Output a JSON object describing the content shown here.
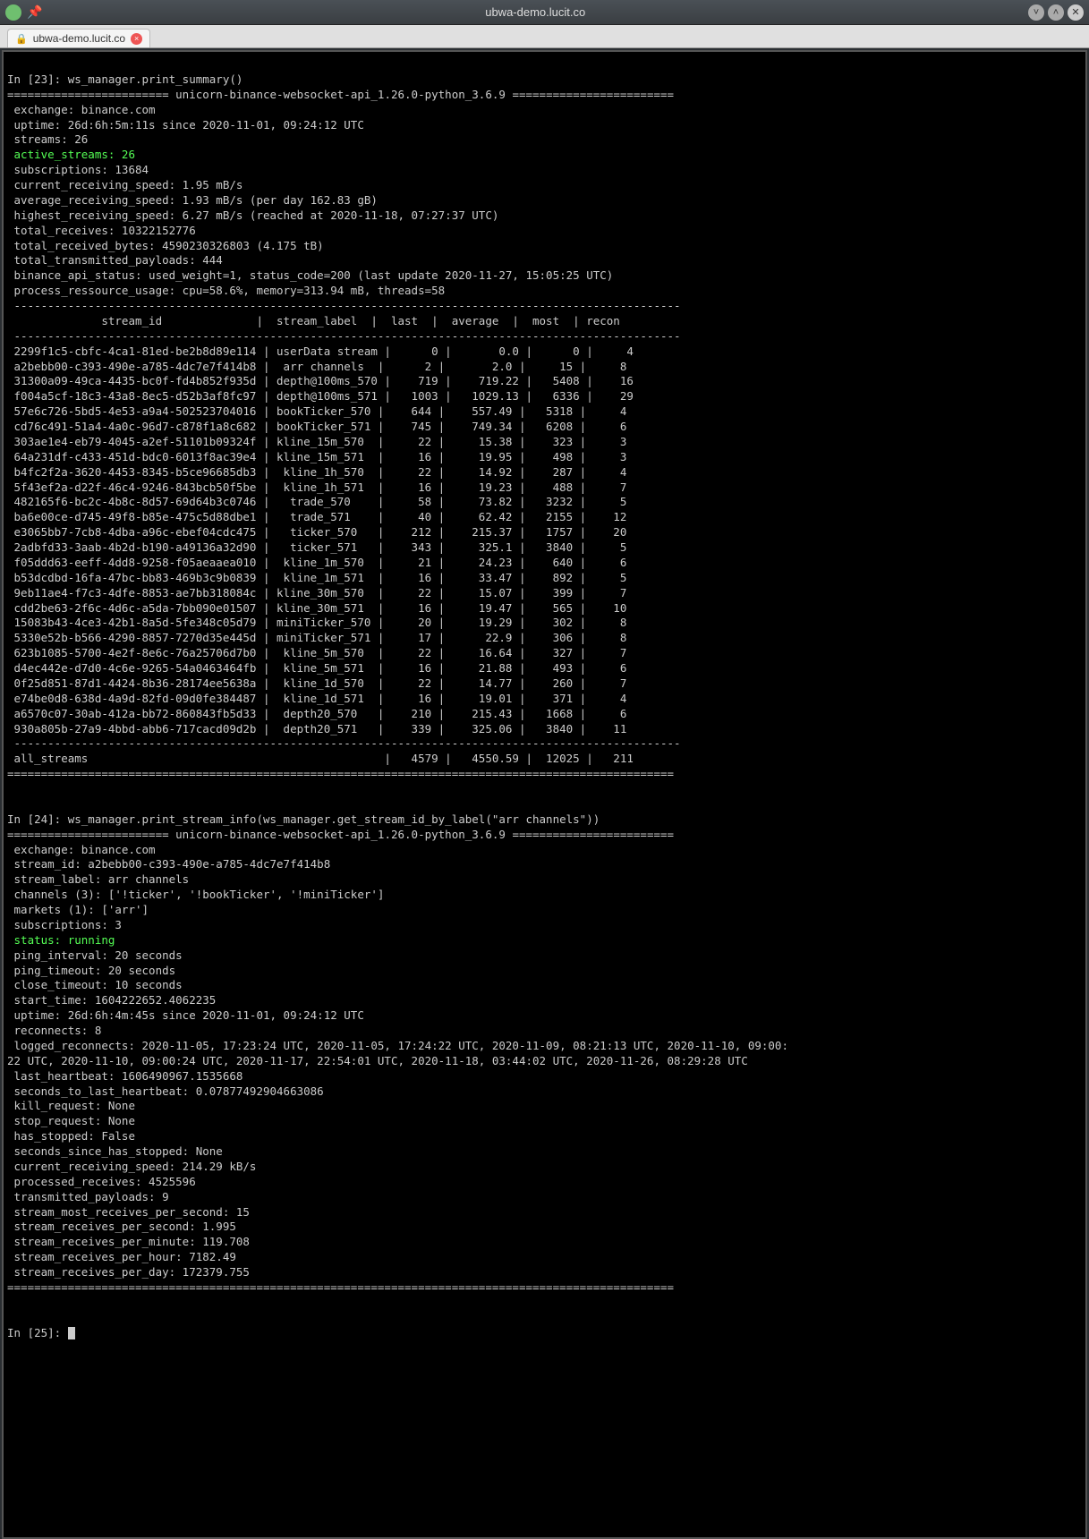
{
  "window": {
    "title": "ubwa-demo.lucit.co",
    "tab_label": "ubwa-demo.lucit.co"
  },
  "session1": {
    "prompt": "In [23]: ",
    "command": "ws_manager.print_summary()",
    "banner_left": "========================",
    "banner_mid": " unicorn-binance-websocket-api_1.26.0-python_3.6.9 ",
    "banner_right": "========================",
    "lines": {
      "exchange": " exchange: binance.com",
      "uptime": " uptime: 26d:6h:5m:11s since 2020-11-01, 09:24:12 UTC",
      "streams": " streams: 26",
      "active_streams": " active_streams: 26",
      "subscriptions": " subscriptions: 13684",
      "crs": " current_receiving_speed: 1.95 mB/s",
      "ars": " average_receiving_speed: 1.93 mB/s (per day 162.83 gB)",
      "hrs": " highest_receiving_speed: 6.27 mB/s (reached at 2020-11-18, 07:27:37 UTC)",
      "total_receives": " total_receives: 10322152776",
      "total_received_bytes": " total_received_bytes: 4590230326803 (4.175 tB)",
      "ttp": " total_transmitted_payloads: 444",
      "api_status": " binance_api_status: used_weight=1, status_code=200 (last update 2020-11-27, 15:05:25 UTC)",
      "ressource": " process_ressource_usage: cpu=58.6%, memory=313.94 mB, threads=58"
    },
    "sep": " ---------------------------------------------------------------------------------------------------",
    "header": "              stream_id              |  stream_label  |  last  |  average  |  most  | recon",
    "rows": [
      " 2299f1c5-cbfc-4ca1-81ed-be2b8d89e114 | userData stream |      0 |       0.0 |      0 |     4",
      " a2bebb00-c393-490e-a785-4dc7e7f414b8 |  arr channels  |      2 |       2.0 |     15 |     8",
      " 31300a09-49ca-4435-bc0f-fd4b852f935d | depth@100ms_570 |    719 |    719.22 |   5408 |    16",
      " f004a5cf-18c3-43a8-8ec5-d52b3af8fc97 | depth@100ms_571 |   1003 |   1029.13 |   6336 |    29",
      " 57e6c726-5bd5-4e53-a9a4-502523704016 | bookTicker_570 |    644 |    557.49 |   5318 |     4",
      " cd76c491-51a4-4a0c-96d7-c878f1a8c682 | bookTicker_571 |    745 |    749.34 |   6208 |     6",
      " 303ae1e4-eb79-4045-a2ef-51101b09324f | kline_15m_570  |     22 |     15.38 |    323 |     3",
      " 64a231df-c433-451d-bdc0-6013f8ac39e4 | kline_15m_571  |     16 |     19.95 |    498 |     3",
      " b4fc2f2a-3620-4453-8345-b5ce96685db3 |  kline_1h_570  |     22 |     14.92 |    287 |     4",
      " 5f43ef2a-d22f-46c4-9246-843bcb50f5be |  kline_1h_571  |     16 |     19.23 |    488 |     7",
      " 482165f6-bc2c-4b8c-8d57-69d64b3c0746 |   trade_570    |     58 |     73.82 |   3232 |     5",
      " ba6e00ce-d745-49f8-b85e-475c5d88dbe1 |   trade_571    |     40 |     62.42 |   2155 |    12",
      " e3065bb7-7cb8-4dba-a96c-ebef04cdc475 |   ticker_570   |    212 |    215.37 |   1757 |    20",
      " 2adbfd33-3aab-4b2d-b190-a49136a32d90 |   ticker_571   |    343 |     325.1 |   3840 |     5",
      " f05ddd63-eeff-4dd8-9258-f05aeaaea010 |  kline_1m_570  |     21 |     24.23 |    640 |     6",
      " b53dcdbd-16fa-47bc-bb83-469b3c9b0839 |  kline_1m_571  |     16 |     33.47 |    892 |     5",
      " 9eb11ae4-f7c3-4dfe-8853-ae7bb318084c | kline_30m_570  |     22 |     15.07 |    399 |     7",
      " cdd2be63-2f6c-4d6c-a5da-7bb090e01507 | kline_30m_571  |     16 |     19.47 |    565 |    10",
      " 15083b43-4ce3-42b1-8a5d-5fe348c05d79 | miniTicker_570 |     20 |     19.29 |    302 |     8",
      " 5330e52b-b566-4290-8857-7270d35e445d | miniTicker_571 |     17 |      22.9 |    306 |     8",
      " 623b1085-5700-4e2f-8e6c-76a25706d7b0 |  kline_5m_570  |     22 |     16.64 |    327 |     7",
      " d4ec442e-d7d0-4c6e-9265-54a0463464fb |  kline_5m_571  |     16 |     21.88 |    493 |     6",
      " 0f25d851-87d1-4424-8b36-28174ee5638a |  kline_1d_570  |     22 |     14.77 |    260 |     7",
      " e74be0d8-638d-4a9d-82fd-09d0fe384487 |  kline_1d_571  |     16 |     19.01 |    371 |     4",
      " a6570c07-30ab-412a-bb72-860843fb5d33 |  depth20_570   |    210 |    215.43 |   1668 |     6",
      " 930a805b-27a9-4bbd-abb6-717cacd09d2b |  depth20_571   |    339 |    325.06 |   3840 |    11"
    ],
    "footer_row": " all_streams                                            |   4579 |   4550.59 |  12025 |   211",
    "footer_sep": "==================================================================================================="
  },
  "session2": {
    "prompt": "In [24]: ",
    "command": "ws_manager.print_stream_info(ws_manager.get_stream_id_by_label(\"arr channels\"))",
    "banner_left": "========================",
    "banner_mid": " unicorn-binance-websocket-api_1.26.0-python_3.6.9 ",
    "banner_right": "========================",
    "lines": {
      "exchange": " exchange: binance.com",
      "stream_id": " stream_id: a2bebb00-c393-490e-a785-4dc7e7f414b8",
      "stream_label": " stream_label: arr channels",
      "channels": " channels (3): ['!ticker', '!bookTicker', '!miniTicker']",
      "markets": " markets (1): ['arr']",
      "subscriptions": " subscriptions: 3",
      "status": " status: running",
      "ping_interval": " ping_interval: 20 seconds",
      "ping_timeout": " ping_timeout: 20 seconds",
      "close_timeout": " close_timeout: 10 seconds",
      "start_time": " start_time: 1604222652.4062235",
      "uptime": " uptime: 26d:6h:4m:45s since 2020-11-01, 09:24:12 UTC",
      "reconnects": " reconnects: 8",
      "logged_reconnects": " logged_reconnects: 2020-11-05, 17:23:24 UTC, 2020-11-05, 17:24:22 UTC, 2020-11-09, 08:21:13 UTC, 2020-11-10, 09:00:",
      "logged_reconnects2": "22 UTC, 2020-11-10, 09:00:24 UTC, 2020-11-17, 22:54:01 UTC, 2020-11-18, 03:44:02 UTC, 2020-11-26, 08:29:28 UTC",
      "last_heartbeat": " last_heartbeat: 1606490967.1535668",
      "seconds_to_lh": " seconds_to_last_heartbeat: 0.07877492904663086",
      "kill_request": " kill_request: None",
      "stop_request": " stop_request: None",
      "has_stopped": " has_stopped: False",
      "seconds_since": " seconds_since_has_stopped: None",
      "crs": " current_receiving_speed: 214.29 kB/s",
      "processed_receives": " processed_receives: 4525596",
      "transmitted_payloads": " transmitted_payloads: 9",
      "smrps": " stream_most_receives_per_second: 15",
      "srps": " stream_receives_per_second: 1.995",
      "srpm": " stream_receives_per_minute: 119.708",
      "srph": " stream_receives_per_hour: 7182.49",
      "srpd": " stream_receives_per_day: 172379.755"
    },
    "footer_sep": "==================================================================================================="
  },
  "session3": {
    "prompt": "In [25]: "
  }
}
